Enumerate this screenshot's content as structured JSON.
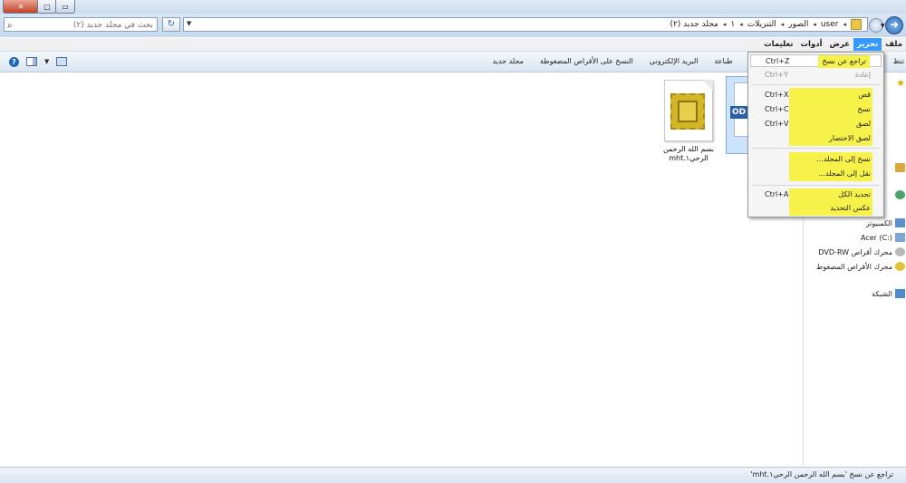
{
  "window": {
    "controls": {
      "close_glyph": "✕",
      "maximize_glyph": "▢",
      "minimize_glyph": "▭"
    }
  },
  "address_bar": {
    "search_placeholder": "بحث في مجلد جديد (٢)",
    "breadcrumbs": [
      "user",
      "الصور",
      "التنزيلات",
      "١",
      "مجلد جديد (٢)"
    ],
    "refresh_glyph": "↻"
  },
  "menu": {
    "items": [
      "ملف",
      "تحرير",
      "عرض",
      "أدوات",
      "تعليمات"
    ],
    "active": "تحرير"
  },
  "toolbar": {
    "partial_left": "تنظ",
    "items": [
      "طباعة",
      "البريد الإلكتروني",
      "النسخ على الأقراص المضغوطة",
      "مجلد جديد"
    ]
  },
  "edit_menu": {
    "undo": {
      "label": "تراجع عن نسخ",
      "shortcut": "Ctrl+Z"
    },
    "redo": {
      "label": "إعادة",
      "shortcut": "Ctrl+Y"
    },
    "cut": {
      "label": "قص",
      "shortcut": "Ctrl+X"
    },
    "copy": {
      "label": "نسخ",
      "shortcut": "Ctrl+C"
    },
    "paste": {
      "label": "لصق",
      "shortcut": "Ctrl+V"
    },
    "paste_shortcut": {
      "label": "لصق الاختصار"
    },
    "copy_to": {
      "label": "نسخ إلى المجلد..."
    },
    "move_to": {
      "label": "نقل إلى المجلد..."
    },
    "select_all": {
      "label": "تحديد الكل",
      "shortcut": "Ctrl+A"
    },
    "invert": {
      "label": "عكس التحديد"
    },
    "highlight_color": "#f6f24a"
  },
  "files": [
    {
      "name_line1": "بسم الله الرحمن",
      "name_line2": "الرحي١.mht",
      "icon": "mht-document-icon"
    },
    {
      "badge": "OD",
      "icon": "odt-document-icon"
    }
  ],
  "nav_pane": {
    "computer": "الكمبيوتر",
    "drive_c": "Acer (C:)",
    "dvd": "محرك أقراص DVD-RW",
    "cd": "محرك الأقراص المضغوط",
    "network": "الشبكة"
  },
  "status_bar": {
    "text": "تراجع عن نسخ 'بسم الله الرحمن الرحي١.mht'"
  }
}
